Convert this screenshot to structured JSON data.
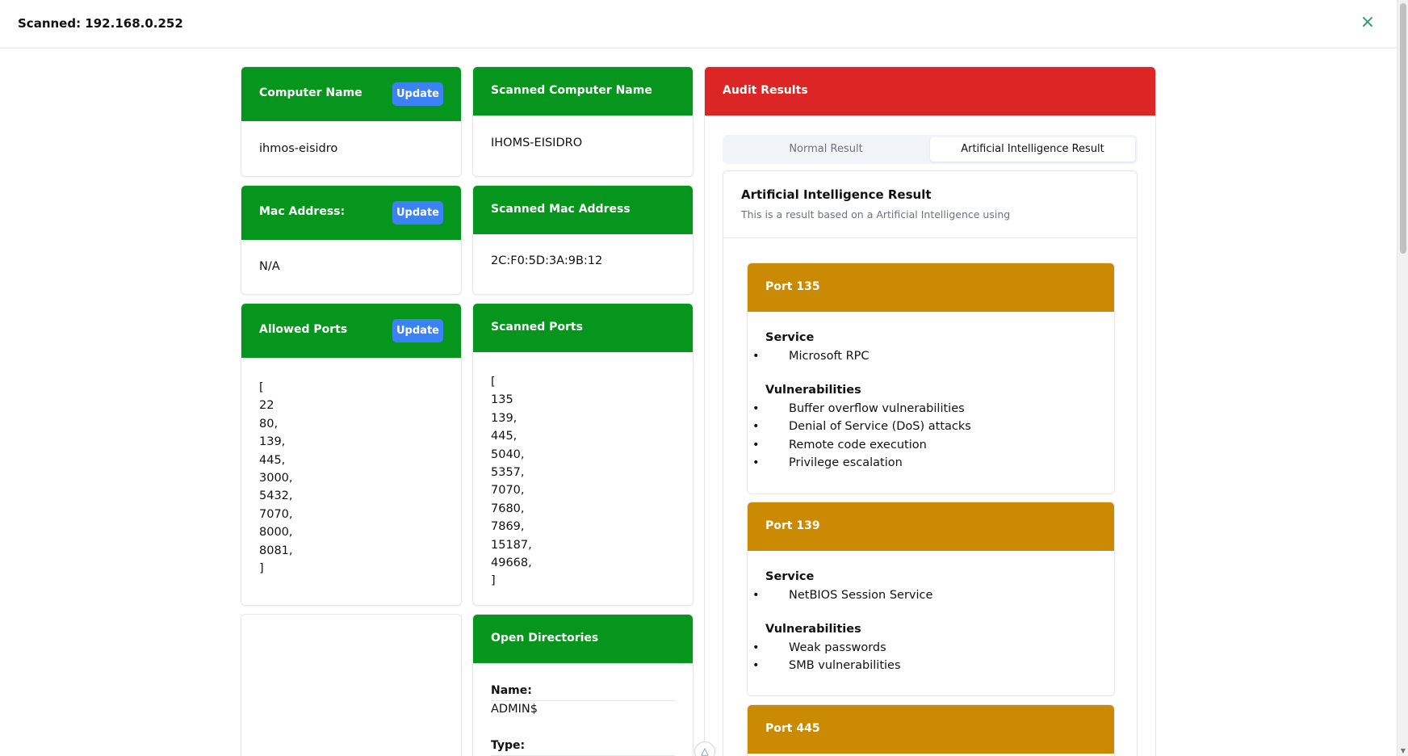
{
  "header": {
    "title": "Scanned: 192.168.0.252",
    "close_label": "×"
  },
  "computer_name": {
    "title": "Computer Name",
    "update_label": "Update",
    "value": "ihmos-eisidro"
  },
  "scanned_computer_name": {
    "title": "Scanned Computer Name",
    "value": "IHOMS-EISIDRO"
  },
  "mac_address": {
    "title": "Mac Address:",
    "update_label": "Update",
    "value": "N/A"
  },
  "scanned_mac_address": {
    "title": "Scanned Mac Address",
    "value": "2C:F0:5D:3A:9B:12"
  },
  "allowed_ports": {
    "title": "Allowed Ports",
    "update_label": "Update",
    "lines": [
      "[",
      "22",
      "80,",
      "139,",
      "445,",
      "3000,",
      "5432,",
      "7070,",
      "8000,",
      "8081,",
      "]"
    ]
  },
  "scanned_ports": {
    "title": "Scanned Ports",
    "lines": [
      "[",
      "135",
      "139,",
      "445,",
      "5040,",
      "5357,",
      "7070,",
      "7680,",
      "7869,",
      "15187,",
      "49668,",
      "]"
    ]
  },
  "open_directories": {
    "title": "Open Directories",
    "name_label": "Name:",
    "name_value": "ADMIN$",
    "type_label": "Type:"
  },
  "audit": {
    "title": "Audit Results",
    "tabs": [
      {
        "label": "Normal Result",
        "active": false
      },
      {
        "label": "Artificial Intelligence Result",
        "active": true
      }
    ],
    "ai_title": "Artificial Intelligence Result",
    "ai_subtitle": "This is a result based on a Artificial Intelligence using",
    "ports": [
      {
        "title": "Port 135",
        "service_label": "Service",
        "services": [
          "Microsoft RPC"
        ],
        "vuln_label": "Vulnerabilities",
        "vulnerabilities": [
          "Buffer overflow vulnerabilities",
          "Denial of Service (DoS) attacks",
          "Remote code execution",
          "Privilege escalation"
        ]
      },
      {
        "title": "Port 139",
        "service_label": "Service",
        "services": [
          "NetBIOS Session Service"
        ],
        "vuln_label": "Vulnerabilities",
        "vulnerabilities": [
          "Weak passwords",
          "SMB vulnerabilities"
        ]
      },
      {
        "title": "Port 445"
      }
    ]
  },
  "colors": {
    "green_header": "#06961d",
    "red_header": "#dc2626",
    "gold_header": "#ca8a04",
    "update_button": "#3b82f6",
    "close_icon": "#22a35a"
  },
  "icons": {
    "close": "close-icon",
    "floating": "nuxt-devtools-icon"
  }
}
